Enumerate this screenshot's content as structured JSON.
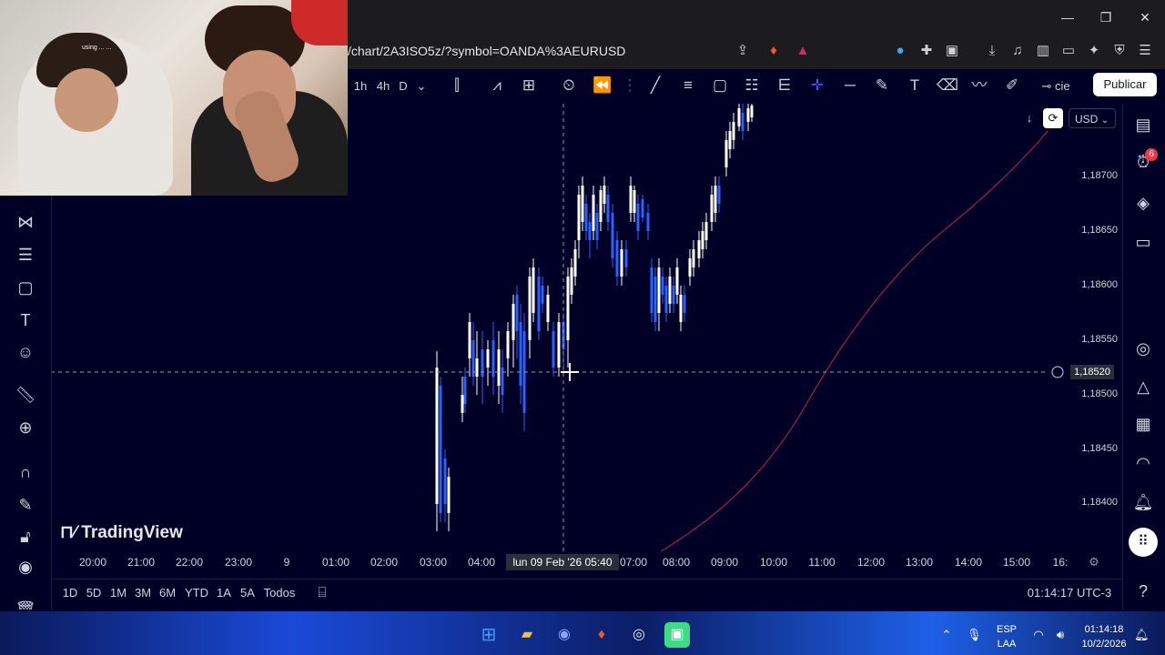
{
  "browser": {
    "url": "/chart/2A3ISO5z/?symbol=OANDA%3AEURUSD",
    "window_buttons": [
      "—",
      "❐",
      "✕"
    ]
  },
  "toolbar": {
    "intervals": [
      "1h",
      "4h",
      "D"
    ],
    "search_label": "cie",
    "publish_label": "Publicar"
  },
  "chart": {
    "currency": "USD",
    "price_labels": [
      "1,18700",
      "1,18650",
      "1,18600",
      "1,18550",
      "1,18500",
      "1,18450",
      "1,18400"
    ],
    "cursor_price": "1,18520",
    "time_labels": [
      "20:00",
      "21:00",
      "22:00",
      "23:00",
      "9",
      "01:00",
      "02:00",
      "03:00",
      "04:00",
      "07:00",
      "08:00",
      "09:00",
      "10:00",
      "11:00",
      "12:00",
      "13:00",
      "14:00",
      "15:00",
      "16:"
    ],
    "cursor_time": "lun 09 Feb '26   05:40",
    "watermark": "TradingView",
    "alert_badge": "6",
    "colors": {
      "background": "#000026",
      "bull": "#ffffff",
      "bear": "#2962ff",
      "ma": "#c2185b"
    }
  },
  "range": {
    "buttons": [
      "1D",
      "5D",
      "1M",
      "3M",
      "6M",
      "YTD",
      "1A",
      "5A",
      "Todos"
    ],
    "clock": "01:14:17 UTC-3"
  },
  "taskbar": {
    "lang": "ESP",
    "lang2": "LAA",
    "time": "01:14:18",
    "date": "10/2/2026"
  },
  "webcam": {
    "overlay_text": "using ... ..."
  }
}
